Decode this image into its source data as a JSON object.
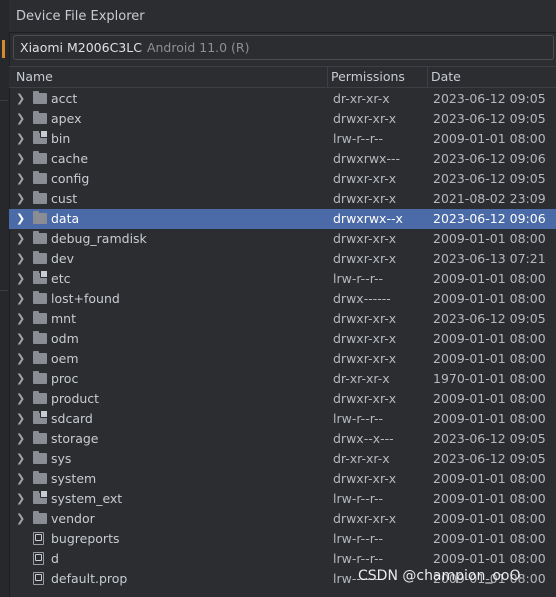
{
  "window": {
    "title": "Device File Explorer"
  },
  "device": {
    "model": "Xiaomi M2006C3LC",
    "android": "Android 11.0 (R)"
  },
  "columns": {
    "name": "Name",
    "permissions": "Permissions",
    "date": "Date"
  },
  "rows": [
    {
      "name": "acct",
      "perm": "dr-xr-xr-x",
      "date": "2023-06-12 09:05",
      "icon": "folder-icon",
      "expandable": true
    },
    {
      "name": "apex",
      "perm": "drwxr-xr-x",
      "date": "2023-06-12 09:05",
      "icon": "folder-icon",
      "expandable": true
    },
    {
      "name": "bin",
      "perm": "lrw-r--r--",
      "date": "2009-01-01 08:00",
      "icon": "folder-link-icon",
      "expandable": true
    },
    {
      "name": "cache",
      "perm": "drwxrwx---",
      "date": "2023-06-12 09:06",
      "icon": "folder-icon",
      "expandable": true
    },
    {
      "name": "config",
      "perm": "drwxr-xr-x",
      "date": "2023-06-12 09:05",
      "icon": "folder-icon",
      "expandable": true
    },
    {
      "name": "cust",
      "perm": "drwxr-xr-x",
      "date": "2021-08-02 23:09",
      "icon": "folder-icon",
      "expandable": true
    },
    {
      "name": "data",
      "perm": "drwxrwx--x",
      "date": "2023-06-12 09:06",
      "icon": "folder-icon",
      "expandable": true,
      "selected": true
    },
    {
      "name": "debug_ramdisk",
      "perm": "drwxr-xr-x",
      "date": "2009-01-01 08:00",
      "icon": "folder-icon",
      "expandable": true
    },
    {
      "name": "dev",
      "perm": "drwxr-xr-x",
      "date": "2023-06-13 07:21",
      "icon": "folder-icon",
      "expandable": true
    },
    {
      "name": "etc",
      "perm": "lrw-r--r--",
      "date": "2009-01-01 08:00",
      "icon": "folder-link-icon",
      "expandable": true
    },
    {
      "name": "lost+found",
      "perm": "drwx------",
      "date": "2009-01-01 08:00",
      "icon": "folder-icon",
      "expandable": true
    },
    {
      "name": "mnt",
      "perm": "drwxr-xr-x",
      "date": "2023-06-12 09:05",
      "icon": "folder-icon",
      "expandable": true
    },
    {
      "name": "odm",
      "perm": "drwxr-xr-x",
      "date": "2009-01-01 08:00",
      "icon": "folder-icon",
      "expandable": true
    },
    {
      "name": "oem",
      "perm": "drwxr-xr-x",
      "date": "2009-01-01 08:00",
      "icon": "folder-icon",
      "expandable": true
    },
    {
      "name": "proc",
      "perm": "dr-xr-xr-x",
      "date": "1970-01-01 08:00",
      "icon": "folder-icon",
      "expandable": true
    },
    {
      "name": "product",
      "perm": "drwxr-xr-x",
      "date": "2009-01-01 08:00",
      "icon": "folder-icon",
      "expandable": true
    },
    {
      "name": "sdcard",
      "perm": "lrw-r--r--",
      "date": "2009-01-01 08:00",
      "icon": "folder-link-icon",
      "expandable": true
    },
    {
      "name": "storage",
      "perm": "drwx--x---",
      "date": "2023-06-12 09:05",
      "icon": "folder-icon",
      "expandable": true
    },
    {
      "name": "sys",
      "perm": "dr-xr-xr-x",
      "date": "2023-06-12 09:05",
      "icon": "folder-icon",
      "expandable": true
    },
    {
      "name": "system",
      "perm": "drwxr-xr-x",
      "date": "2009-01-01 08:00",
      "icon": "folder-icon",
      "expandable": true
    },
    {
      "name": "system_ext",
      "perm": "lrw-r--r--",
      "date": "2009-01-01 08:00",
      "icon": "folder-link-icon",
      "expandable": true
    },
    {
      "name": "vendor",
      "perm": "drwxr-xr-x",
      "date": "2009-01-01 08:00",
      "icon": "folder-icon",
      "expandable": true
    },
    {
      "name": "bugreports",
      "perm": "lrw-r--r--",
      "date": "2009-01-01 08:00",
      "icon": "file-link-icon",
      "expandable": false
    },
    {
      "name": "d",
      "perm": "lrw-r--r--",
      "date": "2009-01-01 08:00",
      "icon": "file-link-icon",
      "expandable": false
    },
    {
      "name": "default.prop",
      "perm": "lrw-------",
      "date": "2009-01-01 08:00",
      "icon": "file-link-icon",
      "expandable": false
    }
  ],
  "watermark": "CSDN @champion_ooO",
  "colors": {
    "selection": "#4a6aa8",
    "background": "#2b2d30",
    "accent": "#d68a2e"
  }
}
